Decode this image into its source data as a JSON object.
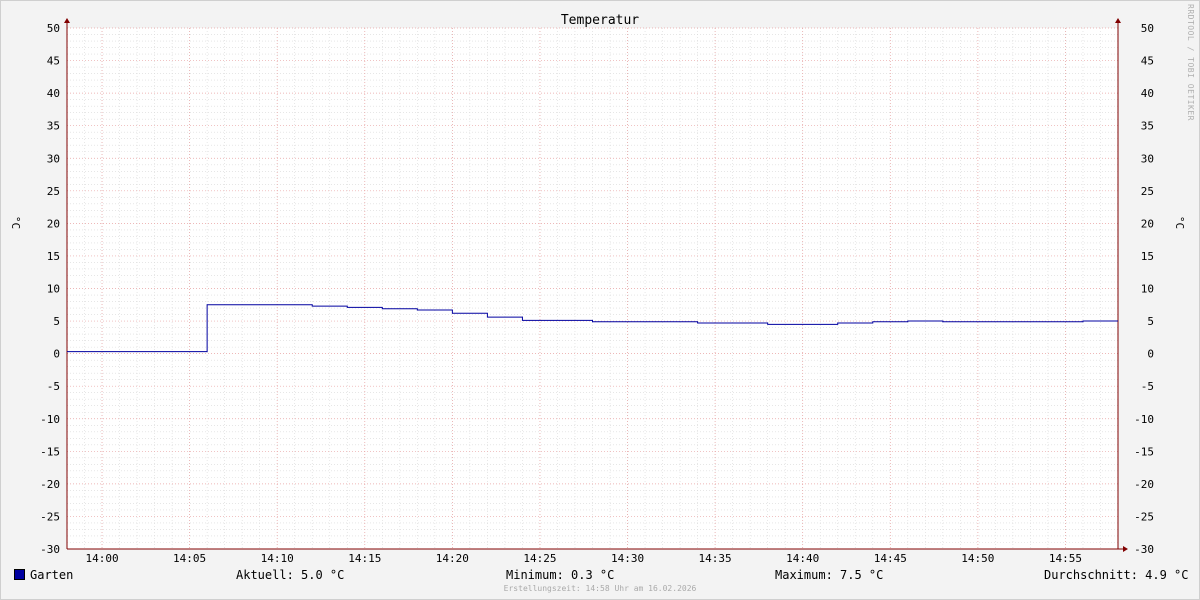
{
  "chart_data": {
    "type": "line",
    "title": "Temperatur",
    "ylabel": "°C",
    "ylabel_right": "°C",
    "ylim": [
      -30,
      50
    ],
    "y_ticks": [
      "50",
      "45",
      "40",
      "35",
      "30",
      "25",
      "20",
      "15",
      "10",
      "5",
      "0",
      "-5",
      "-10",
      "-15",
      "-20",
      "-25",
      "-30"
    ],
    "x_tick_labels": [
      "14:00",
      "14:05",
      "14:10",
      "14:15",
      "14:20",
      "14:25",
      "14:30",
      "14:35",
      "14:40",
      "14:45",
      "14:50",
      "14:55"
    ],
    "x_tick_minutes": [
      0,
      5,
      10,
      15,
      20,
      25,
      30,
      35,
      40,
      45,
      50,
      55
    ],
    "x_start": "13:58",
    "x_end": "14:58",
    "grid": true,
    "series": [
      {
        "name": "Garten",
        "color": "#0000a0",
        "points": [
          [
            "13:58",
            0.3
          ],
          [
            "14:06",
            0.3
          ],
          [
            "14:06",
            7.5
          ],
          [
            "14:12",
            7.5
          ],
          [
            "14:12",
            7.3
          ],
          [
            "14:14",
            7.3
          ],
          [
            "14:14",
            7.1
          ],
          [
            "14:16",
            7.1
          ],
          [
            "14:16",
            6.9
          ],
          [
            "14:18",
            6.9
          ],
          [
            "14:18",
            6.7
          ],
          [
            "14:20",
            6.7
          ],
          [
            "14:20",
            6.2
          ],
          [
            "14:22",
            6.2
          ],
          [
            "14:22",
            5.6
          ],
          [
            "14:24",
            5.6
          ],
          [
            "14:24",
            5.1
          ],
          [
            "14:28",
            5.1
          ],
          [
            "14:28",
            4.9
          ],
          [
            "14:34",
            4.9
          ],
          [
            "14:34",
            4.7
          ],
          [
            "14:38",
            4.7
          ],
          [
            "14:38",
            4.5
          ],
          [
            "14:42",
            4.5
          ],
          [
            "14:42",
            4.7
          ],
          [
            "14:44",
            4.7
          ],
          [
            "14:44",
            4.9
          ],
          [
            "14:46",
            4.9
          ],
          [
            "14:46",
            5.0
          ],
          [
            "14:48",
            5.0
          ],
          [
            "14:48",
            4.9
          ],
          [
            "14:56",
            4.9
          ],
          [
            "14:56",
            5.0
          ],
          [
            "14:58",
            5.0
          ]
        ]
      }
    ]
  },
  "legend": {
    "series_name": "Garten",
    "current": "Aktuell: 5.0 °C",
    "minimum": "Minimum: 0.3 °C",
    "maximum": "Maximum: 7.5 °C",
    "average": "Durchschnitt: 4.9 °C"
  },
  "footer": "Erstellungszeit: 14:58 Uhr am 16.02.2026",
  "watermark": "RRDTOOL / TOBI OETIKER",
  "colors": {
    "background": "#f3f3f3",
    "canvas": "#ffffff",
    "minor_grid": "#d8d8d8",
    "major_grid": "#e8a0a0",
    "axis": "#800000",
    "series": "#0000a0"
  }
}
